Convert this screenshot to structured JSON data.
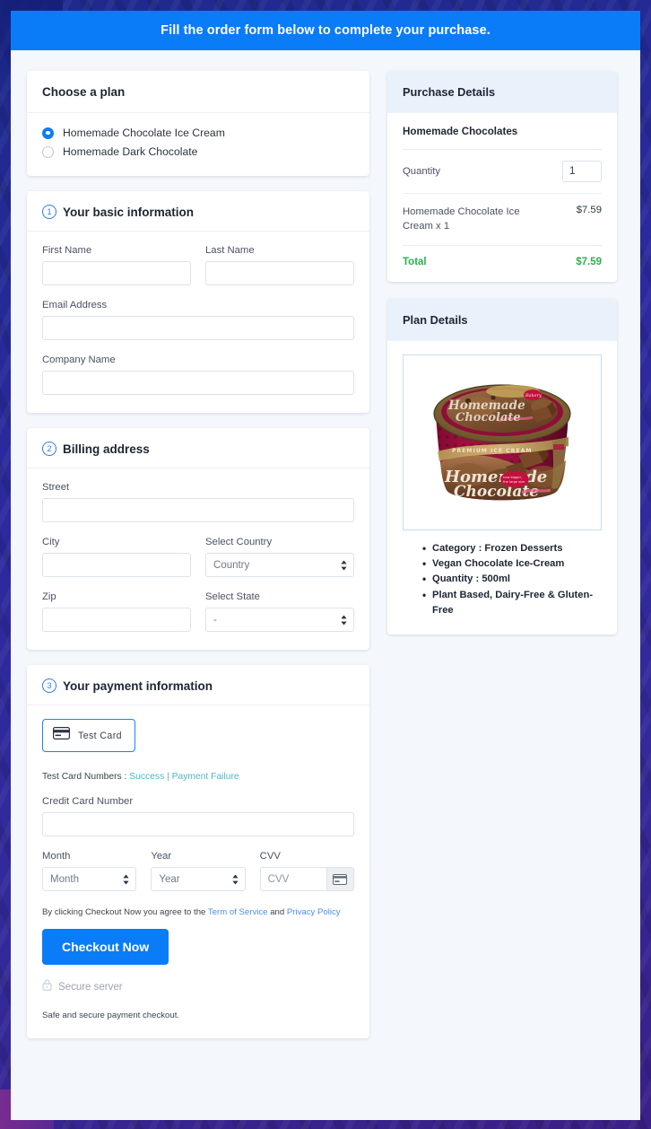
{
  "banner": {
    "text": "Fill the order form below to complete your purchase."
  },
  "plan_card": {
    "title": "Choose a plan",
    "options": [
      {
        "label": "Homemade Chocolate Ice Cream",
        "selected": true
      },
      {
        "label": "Homemade Dark Chocolate",
        "selected": false
      }
    ]
  },
  "basic_info": {
    "step": "1",
    "title": "Your basic information",
    "first_name_label": "First Name",
    "first_name_value": "",
    "last_name_label": "Last Name",
    "last_name_value": "",
    "email_label": "Email Address",
    "email_value": "",
    "company_label": "Company Name",
    "company_value": ""
  },
  "billing": {
    "step": "2",
    "title": "Billing address",
    "street_label": "Street",
    "street_value": "",
    "city_label": "City",
    "city_value": "",
    "country_label": "Select Country",
    "country_value": "Country",
    "zip_label": "Zip",
    "zip_value": "",
    "state_label": "Select State",
    "state_value": "-"
  },
  "payment": {
    "step": "3",
    "title": "Your payment information",
    "test_card_button": "Test  Card",
    "test_numbers_prefix": "Test Card Numbers :",
    "test_numbers_success": "Success",
    "test_numbers_separator": "|",
    "test_numbers_failure": "Payment Failure",
    "card_number_label": "Credit Card Number",
    "card_number_value": "",
    "month_label": "Month",
    "month_value": "Month",
    "year_label": "Year",
    "year_value": "Year",
    "cvv_label": "CVV",
    "cvv_placeholder": "CVV",
    "terms_prefix": "By clicking Checkout Now you agree to the",
    "terms_link1": "Term of Service",
    "terms_and": "and",
    "terms_link2": "Privacy Policy",
    "checkout_button": "Checkout Now",
    "secure_server": "Secure server",
    "safe_note": "Safe and secure payment checkout."
  },
  "purchase_details": {
    "title": "Purchase Details",
    "product": "Homemade Chocolates",
    "quantity_label": "Quantity",
    "quantity_value": "1",
    "line_item_name": "Homemade Chocolate Ice Cream x 1",
    "line_item_amount": "$7.59",
    "total_label": "Total",
    "total_amount": "$7.59"
  },
  "plan_details": {
    "title": "Plan Details",
    "image_alt": "Homemade Chocolate premium ice cream tub",
    "image_text_top": "Homemade Chocolate",
    "image_text_premium": "PREMIUM ICE CREAM",
    "image_text_bottom_1": "Homemade",
    "image_text_bottom_2": "Chocolate",
    "bullets": [
      "Category : Frozen Desserts",
      "Vegan Chocolate Ice-Cream",
      "Quantity : 500ml",
      "Plant Based, Dairy-Free & Gluten-Free"
    ]
  },
  "colors": {
    "brand_blue": "#0a7cf7",
    "panel_head_blue": "#e9f1fb",
    "total_green": "#2bb24c",
    "link_teal": "#4cb8c4",
    "page_bg": "#2a2a9c",
    "shell_bg": "#f4f7fb"
  }
}
